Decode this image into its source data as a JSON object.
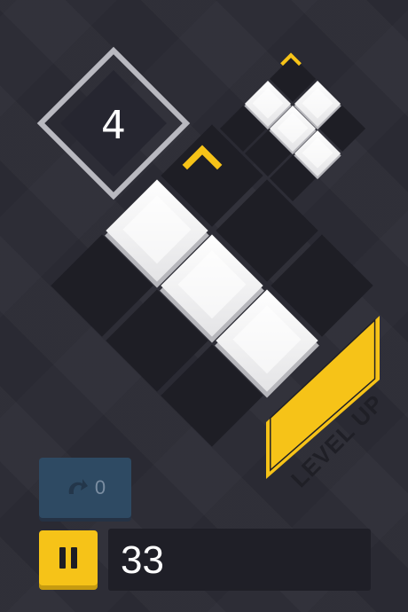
{
  "level": {
    "number": "4"
  },
  "banner": {
    "text": "LEVEL UP"
  },
  "controls": {
    "undo_count": "0",
    "moves": "33"
  },
  "colors": {
    "accent": "#f6c318",
    "bg": "#2d2d36",
    "tile_dark": "#1e1e25",
    "tile_white": "#f2f2f2",
    "frame": "#b9b9c0"
  },
  "icons": {
    "undo": "redo-arrow-icon",
    "pause": "pause-icon",
    "chevron": "chevron-up-icon"
  }
}
